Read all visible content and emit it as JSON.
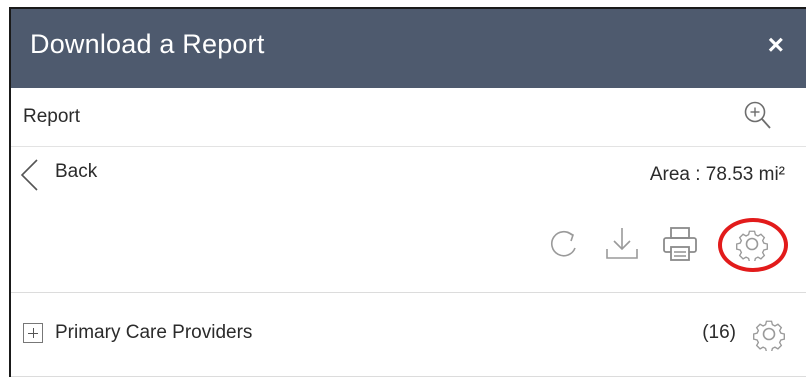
{
  "panel": {
    "title": "Download a Report",
    "close_label": "×"
  },
  "report_row": {
    "label": "Report",
    "zoom_icon": "zoom-in-icon"
  },
  "nav": {
    "back_label": "Back",
    "area_text": "Area : 78.53 mi²"
  },
  "toolbar": {
    "icons": [
      "refresh-icon",
      "download-icon",
      "print-icon",
      "settings-icon"
    ],
    "highlight_color": "#e21b1b"
  },
  "providers": [
    {
      "label": "Primary Care Providers",
      "count": "(16)"
    }
  ],
  "colors": {
    "titlebar_bg": "#4e5a6e",
    "icon_gray": "#9a9a9a"
  }
}
